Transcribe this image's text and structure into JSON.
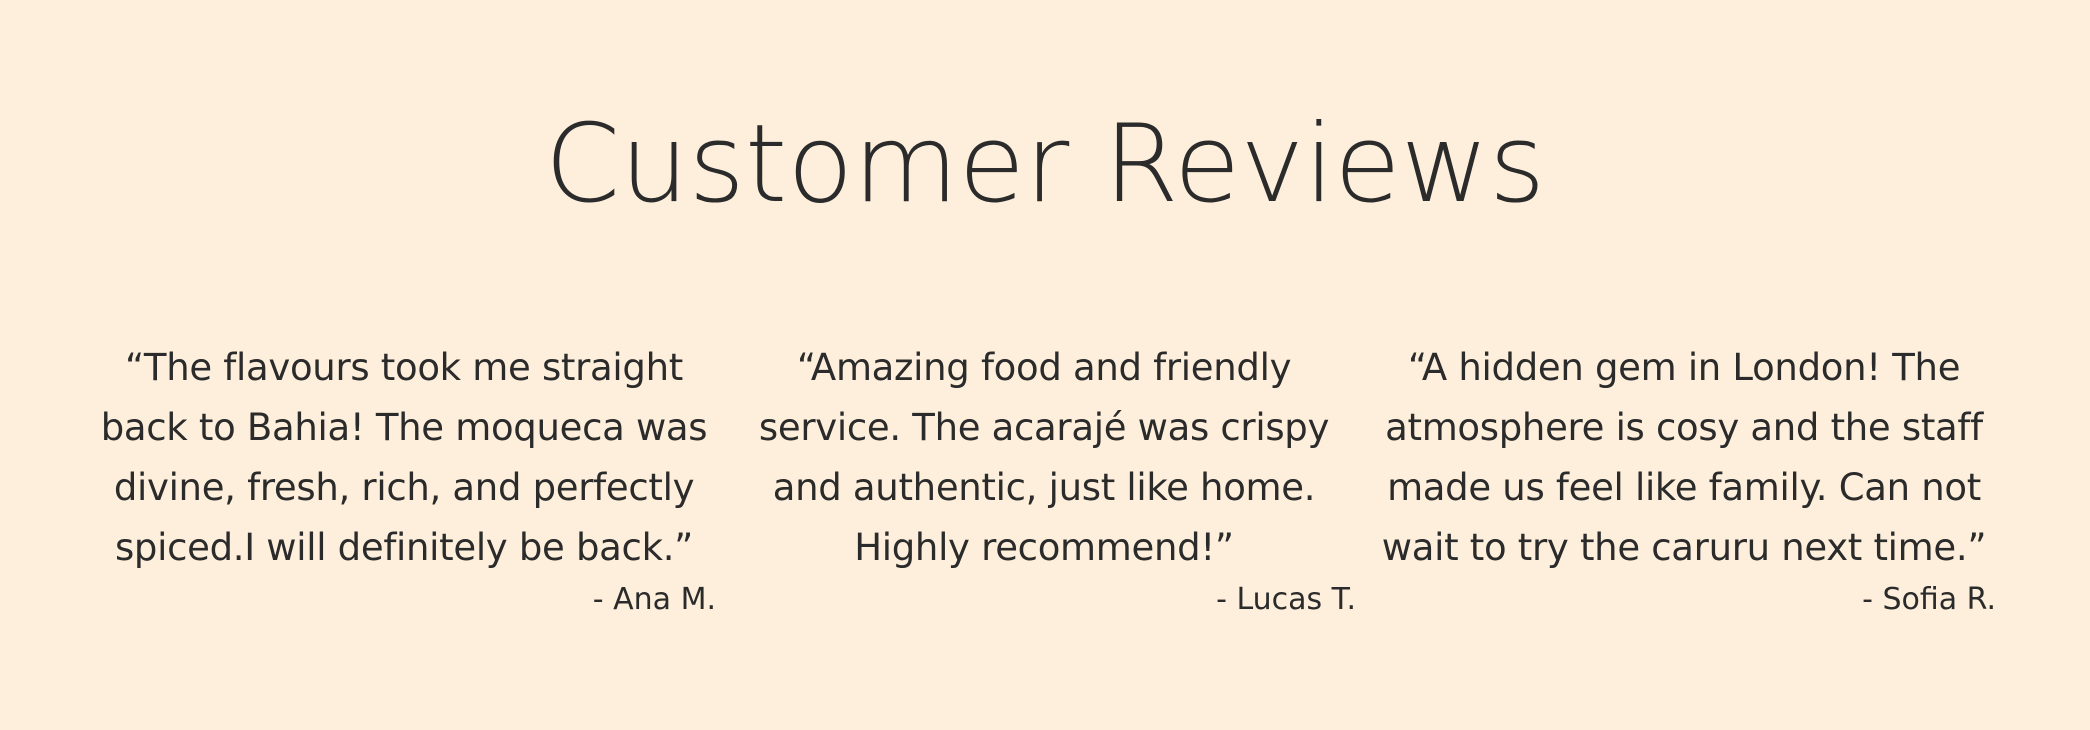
{
  "section": {
    "title": "Customer Reviews"
  },
  "reviews": [
    {
      "quote": "“The flavours took me straight back to Bahia! The moqueca was divine, fresh, rich, and perfectly spiced.I will definitely be back.”",
      "author": "- Ana M."
    },
    {
      "quote": "“Amazing food and friendly service. The acarajé was crispy and authentic, just like home. Highly recommend!”",
      "author": "- Lucas T."
    },
    {
      "quote": "“A hidden gem in London! The atmosphere is cosy and the staff made us feel like family. Can not wait to try the caruru next time.”",
      "author": "- Sofia R."
    }
  ],
  "colors": {
    "background": "#fdefdb",
    "text": "#2b2b2b"
  }
}
